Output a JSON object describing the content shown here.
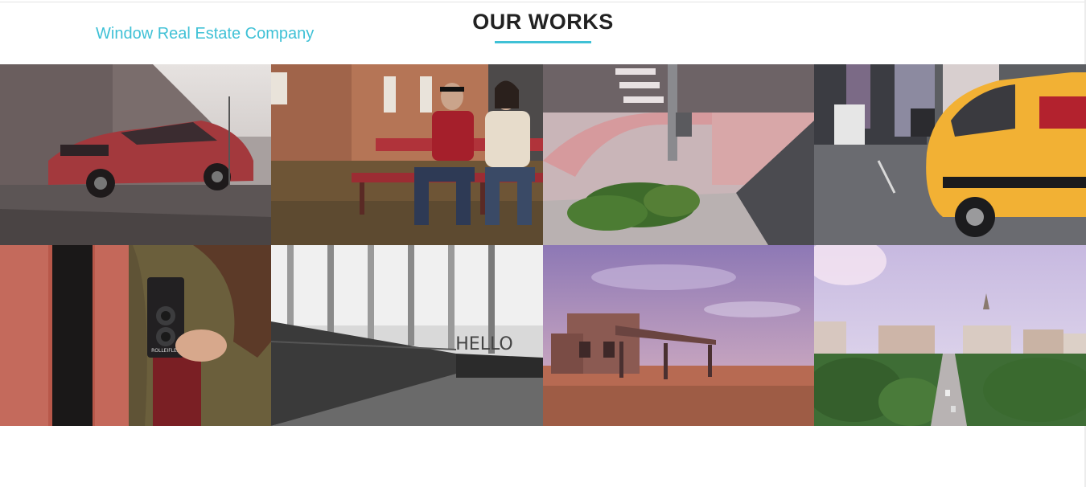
{
  "header": {
    "brand": "Window Real Estate Company",
    "section_title": "OUR WORKS"
  },
  "colors": {
    "accent": "#3fc1d6",
    "title": "#222222"
  },
  "gallery": {
    "items": [
      {
        "icon": "photo-red-sports-car"
      },
      {
        "icon": "photo-couple-on-bench"
      },
      {
        "icon": "photo-street-corner-plant"
      },
      {
        "icon": "photo-yellow-taxi"
      },
      {
        "icon": "photo-person-with-camera",
        "camera_label": "ROLLEIFLEX"
      },
      {
        "icon": "photo-corridor-hello",
        "wall_text": "HELLO"
      },
      {
        "icon": "photo-abandoned-building"
      },
      {
        "icon": "photo-city-aerial"
      }
    ]
  }
}
